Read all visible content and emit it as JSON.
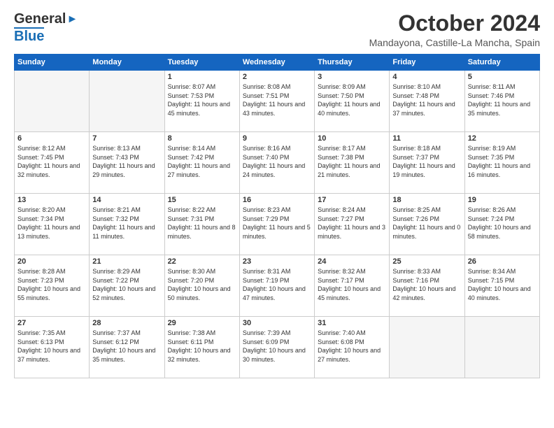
{
  "header": {
    "logo_general": "General",
    "logo_blue": "Blue",
    "month_title": "October 2024",
    "location": "Mandayona, Castille-La Mancha, Spain"
  },
  "weekdays": [
    "Sunday",
    "Monday",
    "Tuesday",
    "Wednesday",
    "Thursday",
    "Friday",
    "Saturday"
  ],
  "weeks": [
    [
      {
        "day": "",
        "info": ""
      },
      {
        "day": "",
        "info": ""
      },
      {
        "day": "1",
        "info": "Sunrise: 8:07 AM\nSunset: 7:53 PM\nDaylight: 11 hours and 45 minutes."
      },
      {
        "day": "2",
        "info": "Sunrise: 8:08 AM\nSunset: 7:51 PM\nDaylight: 11 hours and 43 minutes."
      },
      {
        "day": "3",
        "info": "Sunrise: 8:09 AM\nSunset: 7:50 PM\nDaylight: 11 hours and 40 minutes."
      },
      {
        "day": "4",
        "info": "Sunrise: 8:10 AM\nSunset: 7:48 PM\nDaylight: 11 hours and 37 minutes."
      },
      {
        "day": "5",
        "info": "Sunrise: 8:11 AM\nSunset: 7:46 PM\nDaylight: 11 hours and 35 minutes."
      }
    ],
    [
      {
        "day": "6",
        "info": "Sunrise: 8:12 AM\nSunset: 7:45 PM\nDaylight: 11 hours and 32 minutes."
      },
      {
        "day": "7",
        "info": "Sunrise: 8:13 AM\nSunset: 7:43 PM\nDaylight: 11 hours and 29 minutes."
      },
      {
        "day": "8",
        "info": "Sunrise: 8:14 AM\nSunset: 7:42 PM\nDaylight: 11 hours and 27 minutes."
      },
      {
        "day": "9",
        "info": "Sunrise: 8:16 AM\nSunset: 7:40 PM\nDaylight: 11 hours and 24 minutes."
      },
      {
        "day": "10",
        "info": "Sunrise: 8:17 AM\nSunset: 7:38 PM\nDaylight: 11 hours and 21 minutes."
      },
      {
        "day": "11",
        "info": "Sunrise: 8:18 AM\nSunset: 7:37 PM\nDaylight: 11 hours and 19 minutes."
      },
      {
        "day": "12",
        "info": "Sunrise: 8:19 AM\nSunset: 7:35 PM\nDaylight: 11 hours and 16 minutes."
      }
    ],
    [
      {
        "day": "13",
        "info": "Sunrise: 8:20 AM\nSunset: 7:34 PM\nDaylight: 11 hours and 13 minutes."
      },
      {
        "day": "14",
        "info": "Sunrise: 8:21 AM\nSunset: 7:32 PM\nDaylight: 11 hours and 11 minutes."
      },
      {
        "day": "15",
        "info": "Sunrise: 8:22 AM\nSunset: 7:31 PM\nDaylight: 11 hours and 8 minutes."
      },
      {
        "day": "16",
        "info": "Sunrise: 8:23 AM\nSunset: 7:29 PM\nDaylight: 11 hours and 5 minutes."
      },
      {
        "day": "17",
        "info": "Sunrise: 8:24 AM\nSunset: 7:27 PM\nDaylight: 11 hours and 3 minutes."
      },
      {
        "day": "18",
        "info": "Sunrise: 8:25 AM\nSunset: 7:26 PM\nDaylight: 11 hours and 0 minutes."
      },
      {
        "day": "19",
        "info": "Sunrise: 8:26 AM\nSunset: 7:24 PM\nDaylight: 10 hours and 58 minutes."
      }
    ],
    [
      {
        "day": "20",
        "info": "Sunrise: 8:28 AM\nSunset: 7:23 PM\nDaylight: 10 hours and 55 minutes."
      },
      {
        "day": "21",
        "info": "Sunrise: 8:29 AM\nSunset: 7:22 PM\nDaylight: 10 hours and 52 minutes."
      },
      {
        "day": "22",
        "info": "Sunrise: 8:30 AM\nSunset: 7:20 PM\nDaylight: 10 hours and 50 minutes."
      },
      {
        "day": "23",
        "info": "Sunrise: 8:31 AM\nSunset: 7:19 PM\nDaylight: 10 hours and 47 minutes."
      },
      {
        "day": "24",
        "info": "Sunrise: 8:32 AM\nSunset: 7:17 PM\nDaylight: 10 hours and 45 minutes."
      },
      {
        "day": "25",
        "info": "Sunrise: 8:33 AM\nSunset: 7:16 PM\nDaylight: 10 hours and 42 minutes."
      },
      {
        "day": "26",
        "info": "Sunrise: 8:34 AM\nSunset: 7:15 PM\nDaylight: 10 hours and 40 minutes."
      }
    ],
    [
      {
        "day": "27",
        "info": "Sunrise: 7:35 AM\nSunset: 6:13 PM\nDaylight: 10 hours and 37 minutes."
      },
      {
        "day": "28",
        "info": "Sunrise: 7:37 AM\nSunset: 6:12 PM\nDaylight: 10 hours and 35 minutes."
      },
      {
        "day": "29",
        "info": "Sunrise: 7:38 AM\nSunset: 6:11 PM\nDaylight: 10 hours and 32 minutes."
      },
      {
        "day": "30",
        "info": "Sunrise: 7:39 AM\nSunset: 6:09 PM\nDaylight: 10 hours and 30 minutes."
      },
      {
        "day": "31",
        "info": "Sunrise: 7:40 AM\nSunset: 6:08 PM\nDaylight: 10 hours and 27 minutes."
      },
      {
        "day": "",
        "info": ""
      },
      {
        "day": "",
        "info": ""
      }
    ]
  ]
}
